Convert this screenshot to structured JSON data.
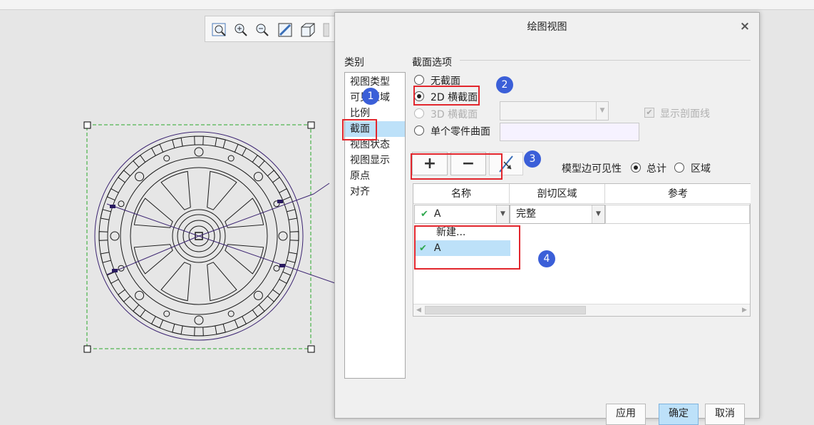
{
  "dialog": {
    "title": "绘图视图",
    "close_label": "×",
    "category_label": "类别",
    "categories": [
      "视图类型",
      "可见区域",
      "比例",
      "截面",
      "视图状态",
      "视图显示",
      "原点",
      "对齐"
    ],
    "selected_category": "截面",
    "section_options": {
      "label": "截面选项",
      "options": [
        {
          "label": "无截面",
          "selected": false,
          "enabled": true
        },
        {
          "label": "2D 横截面",
          "selected": true,
          "enabled": true
        },
        {
          "label": "3D 横截面",
          "selected": false,
          "enabled": false
        },
        {
          "label": "单个零件曲面",
          "selected": false,
          "enabled": true
        }
      ],
      "show_hatch_label": "显示剖面线",
      "show_hatch_checked": true,
      "show_hatch_enabled": false
    },
    "toolbar": {
      "add_label": "+",
      "remove_label": "−"
    },
    "edge_visibility": {
      "label": "模型边可见性",
      "options": [
        {
          "label": "总计",
          "selected": true
        },
        {
          "label": "区域",
          "selected": false
        }
      ]
    },
    "grid": {
      "headers": [
        "名称",
        "剖切区域",
        "参考"
      ],
      "row": {
        "name": "A",
        "region": "完整",
        "reference": ""
      },
      "dropdown": {
        "items": [
          {
            "label": "新建...",
            "checked": false
          },
          {
            "label": "A",
            "checked": true
          }
        ]
      }
    },
    "buttons": {
      "apply": "应用",
      "ok": "确定",
      "cancel": "取消"
    }
  },
  "annotations": [
    "1",
    "2",
    "3",
    "4"
  ],
  "colors": {
    "selection": "#bde1f9",
    "highlight_box": "#e2262d",
    "badge": "#3b5fd8",
    "drawing_line": "#3a2270",
    "view_boundary": "#2aa82a"
  }
}
